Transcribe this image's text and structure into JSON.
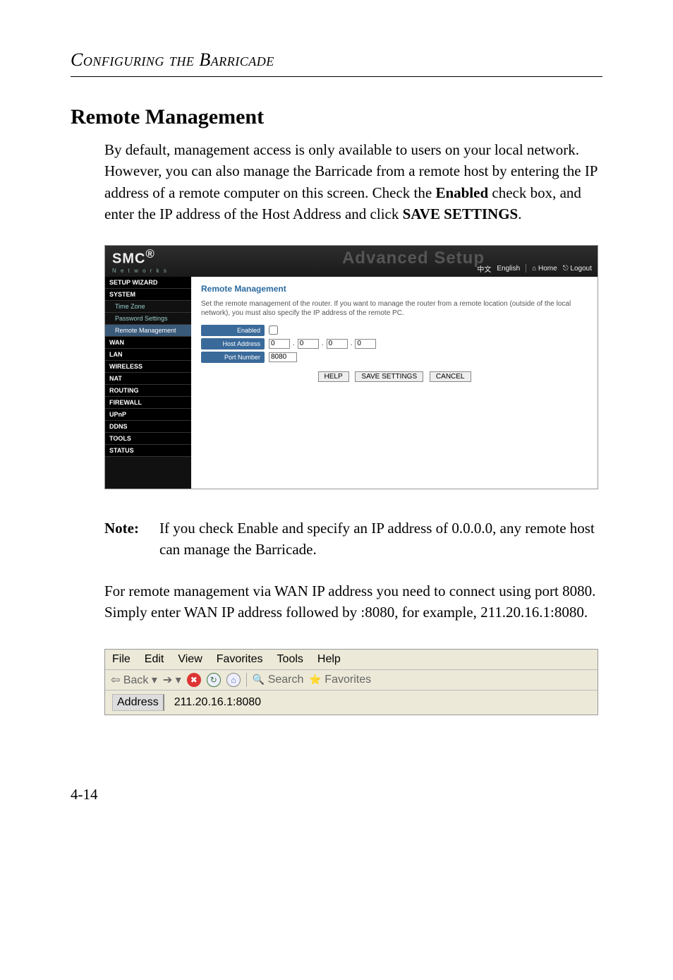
{
  "chapter_header": "Configuring the Barricade",
  "section_title": "Remote Management",
  "intro_html": "By default, management access is only available to users on your local network. However, you can also manage the Barricade from a remote host by entering the IP address of a remote computer on this screen. Check the <b>Enabled</b> check box, and enter the IP address of the Host Address and click <b>SAVE SETTINGS</b>.",
  "router": {
    "logo_brand": "SMC",
    "logo_sub": "N e t w o r k s",
    "adv": "Advanced Setup",
    "toplinks": {
      "cn": "中文",
      "en": "English",
      "home": "Home",
      "logout": "Logout"
    },
    "side": {
      "setup_wizard": "SETUP WIZARD",
      "system": "SYSTEM",
      "time_zone": "Time Zone",
      "password_settings": "Password Settings",
      "remote_management": "Remote Management",
      "wan": "WAN",
      "lan": "LAN",
      "wireless": "WIRELESS",
      "nat": "NAT",
      "routing": "ROUTING",
      "firewall": "FIREWALL",
      "upnp": "UPnP",
      "ddns": "DDNS",
      "tools": "TOOLS",
      "status": "STATUS"
    },
    "main": {
      "title": "Remote Management",
      "desc": "Set the remote management of the router. If you want to manage the router from a remote location (outside of the local network), you must also specify the IP address of the remote PC.",
      "enabled_label": "Enabled",
      "host_label": "Host Address",
      "host": [
        "0",
        "0",
        "0",
        "0"
      ],
      "port_label": "Port Number",
      "port": "8080",
      "btn_help": "HELP",
      "btn_save": "SAVE SETTINGS",
      "btn_cancel": "CANCEL"
    }
  },
  "note_label": "Note:",
  "note_text": "If you check Enable and specify an IP address of 0.0.0.0, any remote host can manage the Barricade.",
  "para2": "For remote management via WAN IP address you need to connect using port 8080. Simply enter WAN IP address followed by :8080, for example, 211.20.16.1:8080.",
  "browser": {
    "menu": {
      "file": "File",
      "edit": "Edit",
      "view": "View",
      "fav": "Favorites",
      "tools": "Tools",
      "help": "Help"
    },
    "toolbar": {
      "back": "Back",
      "search": "Search",
      "favorites": "Favorites"
    },
    "address_label": "Address",
    "address_value": "211.20.16.1:8080"
  },
  "page_number": "4-14"
}
